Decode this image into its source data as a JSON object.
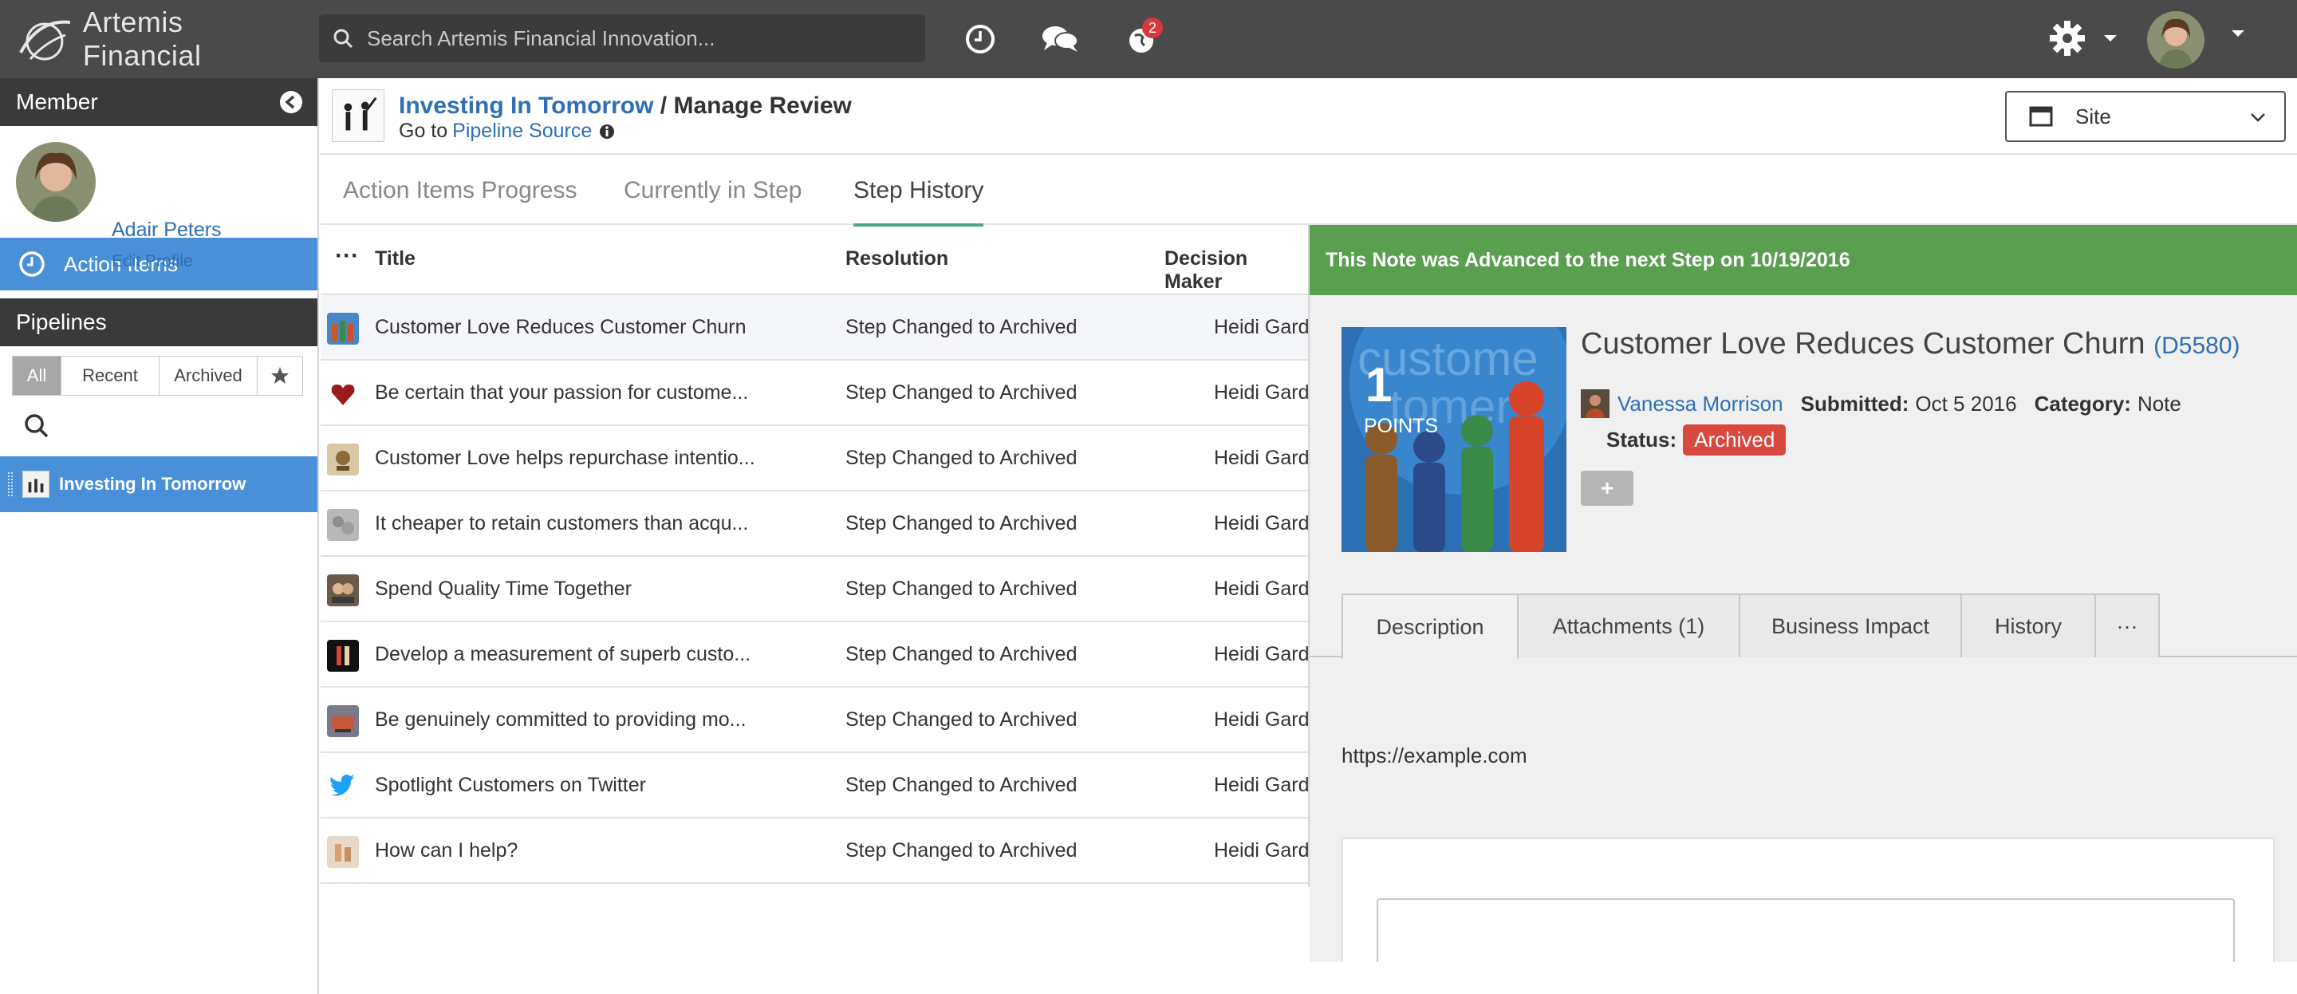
{
  "app": {
    "name": "Artemis Financial"
  },
  "search": {
    "placeholder": "Search Artemis Financial Innovation..."
  },
  "notifications": {
    "count": "2"
  },
  "sidebar": {
    "member_header": "Member",
    "member_name": "Adair Peters",
    "edit_profile": "Edit Profile",
    "action_items": "Action Items",
    "pipelines_header": "Pipelines",
    "filters": [
      "All",
      "Recent",
      "Archived"
    ],
    "pipeline": "Investing In Tomorrow"
  },
  "page": {
    "title_link": "Investing In Tomorrow",
    "title_rest": " / Manage Review",
    "goto_prefix": "Go to",
    "goto_link": "Pipeline Source",
    "site_select": "Site"
  },
  "tabs": [
    "Action Items Progress",
    "Currently in Step",
    "Step History"
  ],
  "table": {
    "headers": {
      "title": "Title",
      "resolution": "Resolution",
      "decision": "Decision Maker"
    },
    "rows": [
      {
        "title": "Customer Love Reduces Customer Churn",
        "resolution": "Step Changed to Archived",
        "decision": "Heidi Gard"
      },
      {
        "title": "Be certain that your passion for custome...",
        "resolution": "Step Changed to Archived",
        "decision": "Heidi Gard"
      },
      {
        "title": "Customer Love helps repurchase intentio...",
        "resolution": "Step Changed to Archived",
        "decision": "Heidi Gard"
      },
      {
        "title": "It cheaper to retain customers than acqu...",
        "resolution": "Step Changed to Archived",
        "decision": "Heidi Gard"
      },
      {
        "title": "Spend Quality Time Together",
        "resolution": "Step Changed to Archived",
        "decision": "Heidi Gard"
      },
      {
        "title": "Develop a measurement of superb custo...",
        "resolution": "Step Changed to Archived",
        "decision": "Heidi Gard"
      },
      {
        "title": "Be genuinely committed to providing mo...",
        "resolution": "Step Changed to Archived",
        "decision": "Heidi Gard"
      },
      {
        "title": "Spotlight Customers on Twitter",
        "resolution": "Step Changed to Archived",
        "decision": "Heidi Gard"
      },
      {
        "title": "How can I help?",
        "resolution": "Step Changed to Archived",
        "decision": "Heidi Gard"
      }
    ]
  },
  "detail": {
    "banner": "This Note was Advanced to the next Step on 10/19/2016",
    "points": "1",
    "points_label": "POINTS",
    "title": "Customer Love Reduces Customer Churn",
    "code": "D5580",
    "author": "Vanessa Morrison",
    "submitted_label": "Submitted:",
    "submitted": "Oct 5 2016",
    "category_label": "Category:",
    "category": "Note",
    "status_label": "Status:",
    "status": "Archived",
    "add": "+",
    "tabs": [
      "Description",
      "Attachments (1)",
      "Business Impact",
      "History",
      "···"
    ],
    "description": "https://example.com"
  },
  "colors": {
    "accent": "#4a90d9",
    "banner": "#5a9e50",
    "status": "#d9493f",
    "link": "#2f6fb5"
  }
}
